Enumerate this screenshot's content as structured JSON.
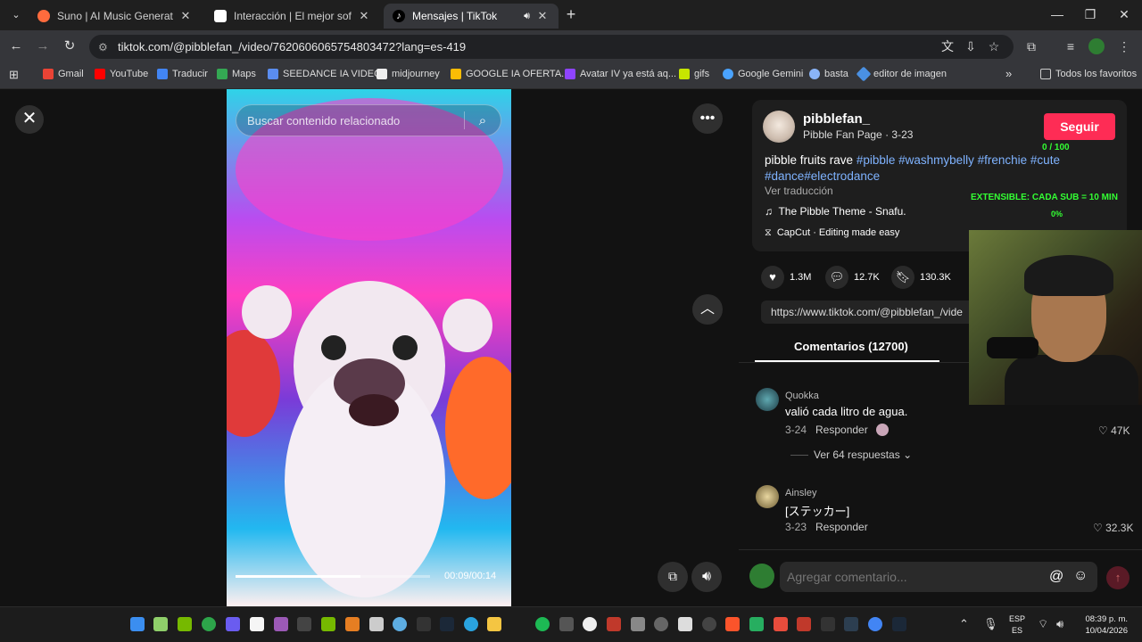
{
  "browser": {
    "tabs": [
      {
        "title": "Suno | AI Music Generator",
        "close": "✕"
      },
      {
        "title": "Interacción | El mejor software",
        "close": "✕"
      },
      {
        "title": "Mensajes | TikTok",
        "close": "✕"
      }
    ],
    "new_tab": "+",
    "url": "tiktok.com/@pibblefan_/video/7620606065754803472?lang=es-419",
    "bookmarks": [
      "Gmail",
      "YouTube",
      "Traducir",
      "Maps",
      "SEEDANCE IA VIDEO",
      "midjourney",
      "GOOGLE IA OFERTA...",
      "Avatar IV ya está aq...",
      "gifs",
      "Google Gemini",
      "basta",
      "editor de imagen"
    ],
    "bookmarks_more": "»",
    "all_favorites": "Todos los favoritos"
  },
  "video": {
    "search_placeholder": "Buscar contenido relacionado",
    "progress": 0.64,
    "time": "00:09/00:14"
  },
  "post": {
    "username": "pibblefan_",
    "subtitle": "Pibble Fan Page · 3-23",
    "follow": "Seguir",
    "desc_text": "pibble fruits rave ",
    "tags1": "#pibble #washmybelly #frenchie #cute",
    "tags2": "#dance#electrodance",
    "translate": "Ver traducción",
    "music": "The Pibble Theme - Snafu.",
    "capcut": "CapCut · Editing made easy",
    "likes": "1.3M",
    "comments_count": "12.7K",
    "saves": "130.3K",
    "link": "https://www.tiktok.com/@pibblefan_/vide"
  },
  "comments": {
    "tab": "Comentarios (12700)",
    "items": [
      {
        "name": "Quokka",
        "text": "valió cada litro de agua.",
        "date": "3-24",
        "reply": "Responder",
        "likes": "47K"
      },
      {
        "name": "Ainsley",
        "text": "[ステッカー]",
        "date": "3-23",
        "reply": "Responder",
        "likes": "32.3K"
      }
    ],
    "more_replies": "Ver 64 respuestas",
    "input_placeholder": "Agregar comentario..."
  },
  "overlay": {
    "counter": "0 / 100",
    "extensible": "EXTENSIBLE: CADA SUB = 10 MIN",
    "percent": "0%"
  },
  "taskbar": {
    "lang1": "ESP",
    "lang2": "ES",
    "time": "08:39 p. m.",
    "date": "10/04/2026"
  },
  "colors": {
    "accent": "#fe2c55",
    "tag": "#7fb3ff",
    "overlay": "#33ff33"
  }
}
